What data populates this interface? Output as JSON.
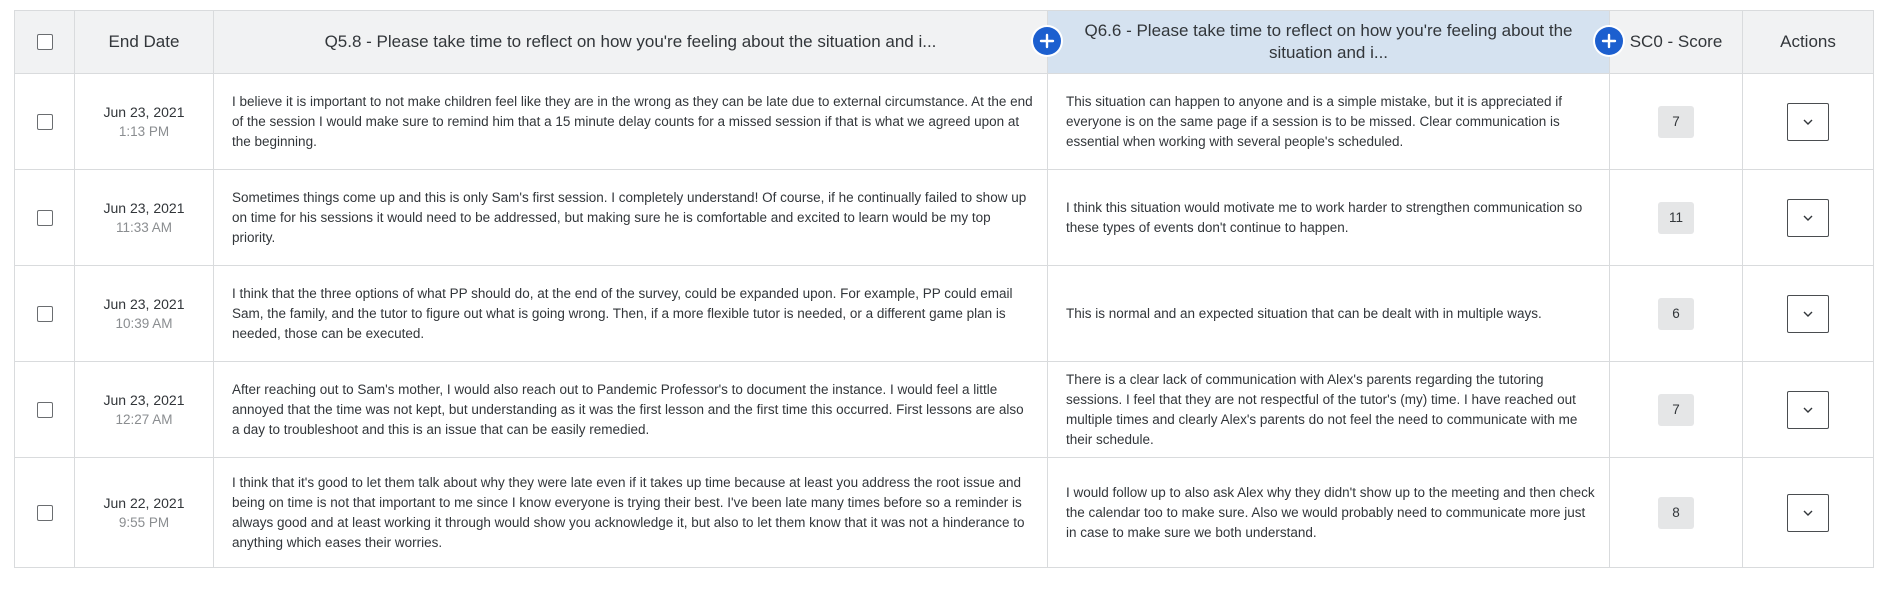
{
  "columns": {
    "end_date": "End Date",
    "q58": "Q5.8 - Please take time to reflect on how you're feeling about the situation and i...",
    "q66": "Q6.6 - Please take time to reflect on how you're feeling about the situation and i...",
    "score": "SC0 - Score",
    "actions": "Actions"
  },
  "colors": {
    "accent": "#1c5fcf",
    "highlight_column": "#d5e2f0",
    "header_bg": "#f1f2f3"
  },
  "rows": [
    {
      "date": "Jun 23, 2021",
      "time": "1:13 PM",
      "q58": "I believe it is important to not make children feel like they are in the wrong as they can be late due to external circumstance. At the end of the session I would make sure to remind him that a 15 minute delay counts for a missed session if that is what we agreed upon at the beginning.",
      "q66": "This situation can happen to anyone and is a simple mistake, but it is appreciated if everyone is on the same page if a session is to be missed. Clear communication is essential when working with several people's scheduled.",
      "score": "7"
    },
    {
      "date": "Jun 23, 2021",
      "time": "11:33 AM",
      "q58": "Sometimes things come up and this is only Sam's first session. I completely understand! Of course, if he continually failed to show up on time for his sessions it would need to be addressed, but making sure he is comfortable and excited to learn would be my top priority.",
      "q66": "I think this situation would motivate me to work harder to strengthen communication so these types of events don't continue to happen.",
      "score": "11"
    },
    {
      "date": "Jun 23, 2021",
      "time": "10:39 AM",
      "q58": "I think that the three options of what PP should do, at the end of the survey, could be expanded upon. For example, PP could email Sam, the family, and the tutor to figure out what is going wrong. Then, if a more flexible tutor is needed, or a different game plan is needed, those can be executed.",
      "q66": "This is normal and an expected situation that can be dealt with in multiple ways.",
      "score": "6"
    },
    {
      "date": "Jun 23, 2021",
      "time": "12:27 AM",
      "q58": "After reaching out to Sam's mother, I would also reach out to Pandemic Professor's to document the instance. I would feel a little annoyed that the time was not kept, but understanding as it was the first lesson and the first time this occurred. First lessons are also a day to troubleshoot and this is an issue that can be easily remedied.",
      "q66": "There is a clear lack of communication with Alex's parents regarding the tutoring sessions. I feel that they are not respectful of the tutor's (my) time. I have reached out multiple times and clearly Alex's parents do not feel the need to communicate with me their schedule.",
      "score": "7"
    },
    {
      "date": "Jun 22, 2021",
      "time": "9:55 PM",
      "q58": "I think that it's good to let them talk about why they were late even if it takes up time because at least you address the root issue and being on time is not that important to me since I know everyone is trying their best. I've been late many times before so a reminder is always good and at least working it through would show you acknowledge it, but also to let them know that it was not a hinderance to anything which eases their worries.",
      "q66": "I would follow up to also ask Alex why they didn't show up to the meeting and then check the calendar too to make sure. Also we would probably need to communicate more just in case to make sure we both understand.",
      "score": "8"
    }
  ]
}
